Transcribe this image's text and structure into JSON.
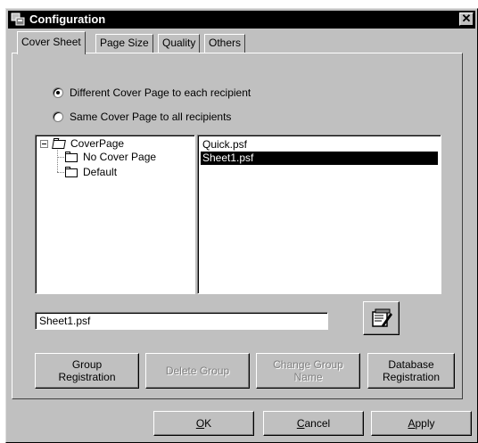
{
  "window": {
    "title": "Configuration",
    "close_glyph": "✕"
  },
  "tabs": [
    {
      "label": "Cover Sheet",
      "active": true
    },
    {
      "label": "Page Size",
      "active": false
    },
    {
      "label": "Quality",
      "active": false
    },
    {
      "label": "Others",
      "active": false
    }
  ],
  "options": {
    "different": {
      "label": "Different Cover Page to each recipient",
      "checked": true
    },
    "same": {
      "label": "Same Cover Page to all recipients",
      "checked": false
    }
  },
  "tree": {
    "root": "CoverPage",
    "children": [
      "No Cover Page",
      "Default"
    ]
  },
  "files": {
    "items": [
      "Quick.psf",
      "Sheet1.psf"
    ],
    "selected": "Sheet1.psf"
  },
  "filename_input": {
    "value": "Sheet1.psf"
  },
  "buttons": {
    "group_registration": "Group\nRegistration",
    "delete_group": "Delete Group",
    "change_group_name": "Change Group\nName",
    "database_registration": "Database\nRegistration",
    "ok_mnemonic": "O",
    "ok_rest": "K",
    "cancel_mnemonic": "C",
    "cancel_rest": "ancel",
    "apply_mnemonic": "A",
    "apply_rest": "pply"
  },
  "icons": {
    "app": "app-icon",
    "edit": "notepad-edit-icon"
  }
}
